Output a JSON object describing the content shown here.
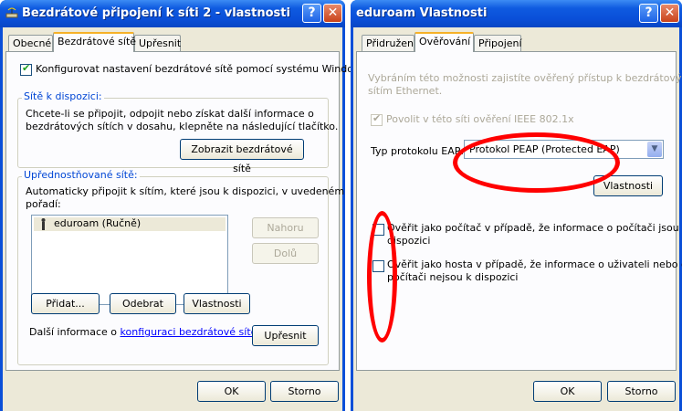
{
  "win1": {
    "title": "Bezdrátové připojení k síti 2 - vlastnosti",
    "tabs": [
      "Obecné",
      "Bezdrátové sítě",
      "Upřesnit"
    ],
    "configure_checkbox": {
      "label": "Konfigurovat nastavení bezdrátové sítě pomocí systému Windows",
      "checked": true
    },
    "available": {
      "title": "Sítě k dispozici:",
      "text1": "Chcete-li se připojit, odpojit nebo získat další informace o",
      "text2": "bezdrátových sítích v dosahu, klepněte na následující tlačítko.",
      "button": "Zobrazit bezdrátové sítě"
    },
    "preferred": {
      "title": "Upřednostňované sítě:",
      "text1": "Automaticky připojit k sítím, které jsou k dispozici, v uvedeném",
      "text2": "pořadí:",
      "networks": [
        "eduroam (Ručně)"
      ],
      "up_button": "Nahoru",
      "down_button": "Dolů",
      "add_button": "Přidat...",
      "remove_button": "Odebrat",
      "props_button": "Vlastnosti"
    },
    "more_info_prefix": "Další informace o ",
    "more_info_link": "konfiguraci bezdrátové sítě",
    "advanced_button": "Upřesnit",
    "ok_button": "OK",
    "cancel_button": "Storno"
  },
  "win2": {
    "title": "eduroam Vlastnosti",
    "tabs": [
      "Přidružení",
      "Ověřování",
      "Připojení"
    ],
    "desc1": "Vybráním této možnosti zajistíte ověřený přístup k bezdrátovým",
    "desc2": "sítím Ethernet.",
    "ieee_checkbox": {
      "label": "Povolit v této síti ověření IEEE 802.1x",
      "checked": true,
      "enabled": false
    },
    "eap_label": "Typ protokolu EAP:",
    "eap_value": "Protokol PEAP (Protected EAP)",
    "props_button": "Vlastnosti",
    "computer_auth": {
      "line1": "Ověřit jako počítač v případě, že informace o počítači jsou k",
      "line2": "dispozici",
      "checked": false
    },
    "guest_auth": {
      "line1": "Ověřit jako hosta v případě, že informace o uživateli nebo o",
      "line2": "počítači nejsou k dispozici",
      "checked": false
    },
    "ok_button": "OK",
    "cancel_button": "Storno"
  },
  "colors": {
    "titlebar": "#0a4fd8",
    "dialog_bg": "#ece9d8",
    "group_title": "#0046d5",
    "highlight_ring": "#ff0000",
    "link": "#0000ff"
  },
  "icons": {
    "help": "?",
    "close": "✕",
    "network": "wireless-network-icon"
  }
}
